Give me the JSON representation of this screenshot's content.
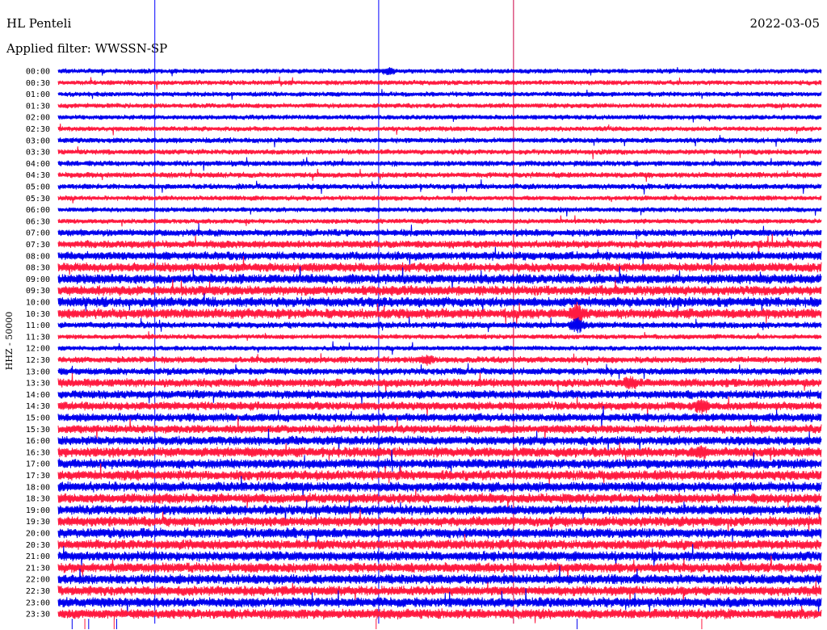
{
  "header": {
    "station": "HL Penteli",
    "filter": "Applied filter: WWSSN-SP",
    "date": "2022-03-05"
  },
  "channel_label": "HHZ - 50000",
  "colors": {
    "trace_a": "#0000ee",
    "trace_b": "#ff1a40",
    "marker_blue": "#0000ff",
    "marker_magenta": "#cc0044"
  },
  "chart_data": {
    "type": "line",
    "time_labels": [
      "00:00",
      "00:30",
      "01:00",
      "01:30",
      "02:00",
      "02:30",
      "03:00",
      "03:30",
      "04:00",
      "04:30",
      "05:00",
      "05:30",
      "06:00",
      "06:30",
      "07:00",
      "07:30",
      "08:00",
      "08:30",
      "09:00",
      "09:30",
      "10:00",
      "10:30",
      "11:00",
      "11:30",
      "12:00",
      "12:30",
      "13:00",
      "13:30",
      "14:00",
      "14:30",
      "15:00",
      "15:30",
      "16:00",
      "16:30",
      "17:00",
      "17:30",
      "18:00",
      "18:30",
      "19:00",
      "19:30",
      "20:00",
      "20:30",
      "21:00",
      "21:30",
      "22:00",
      "22:30",
      "23:00",
      "23:30"
    ],
    "trace_colors": [
      "trace_a",
      "trace_b"
    ],
    "amplitude": [
      3.5,
      3.5,
      3.5,
      3.5,
      3.5,
      3.5,
      3.8,
      3.8,
      4,
      4,
      4,
      3.5,
      3.5,
      3.5,
      5,
      5.5,
      6,
      6.5,
      7,
      7,
      7,
      7,
      4.5,
      3.5,
      3.5,
      4.5,
      5,
      6,
      6,
      6,
      6,
      6,
      6.5,
      7,
      7,
      7,
      7,
      7,
      7,
      7,
      7,
      7,
      7,
      7,
      7,
      7,
      7,
      7
    ],
    "events": [
      {
        "line": 0,
        "minute": 13,
        "strength": 3
      },
      {
        "line": 21,
        "minute": 20.4,
        "strength": 9
      },
      {
        "line": 22,
        "minute": 20.4,
        "strength": 8
      },
      {
        "line": 25,
        "minute": 14.5,
        "strength": 4
      },
      {
        "line": 27,
        "minute": 22.5,
        "strength": 5
      },
      {
        "line": 29,
        "minute": 25.3,
        "strength": 6
      },
      {
        "line": 33,
        "minute": 25.3,
        "strength": 5
      }
    ],
    "markers": [
      {
        "minute": 3.8,
        "color": "marker_blue"
      },
      {
        "minute": 12.6,
        "color": "marker_blue"
      },
      {
        "minute": 17.9,
        "color": "marker_magenta"
      }
    ],
    "minutes_per_line": 30
  }
}
